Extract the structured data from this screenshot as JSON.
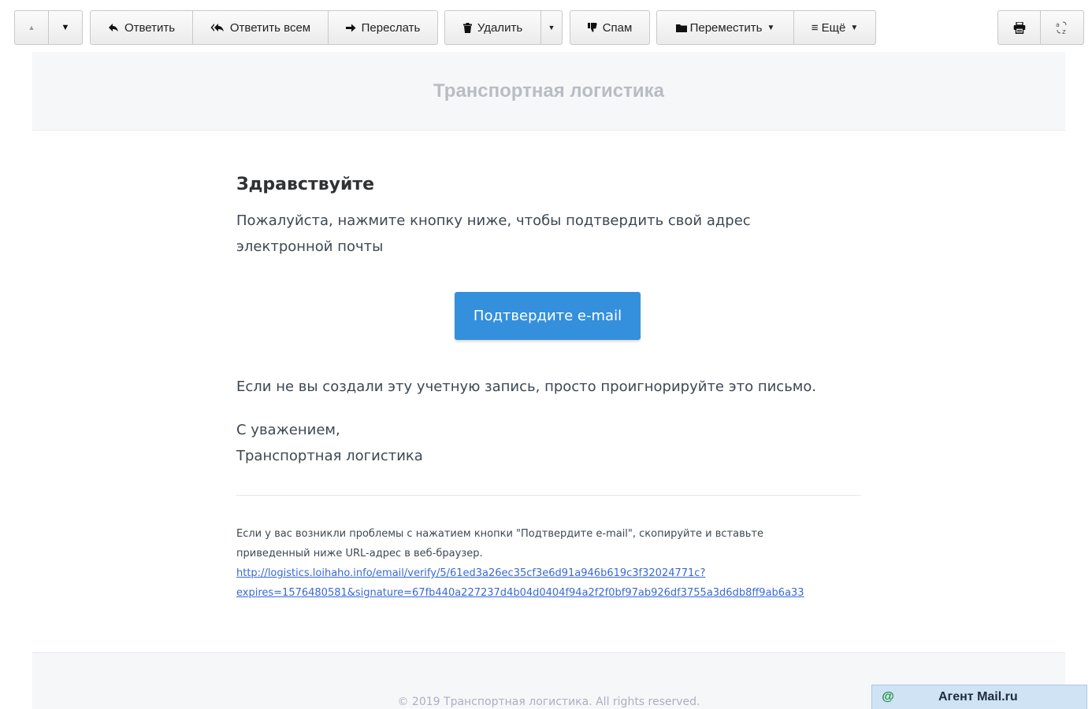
{
  "toolbar": {
    "prev_label": "▲",
    "next_label": "▼",
    "reply_label": "Ответить",
    "reply_all_label": "Ответить всем",
    "forward_label": "Переслать",
    "delete_label": "Удалить",
    "delete_menu_label": "▼",
    "spam_label": "Спам",
    "move_label": "Переместить",
    "more_label": "≡ Ещё",
    "dropdown_caret": "▼"
  },
  "email": {
    "header_brand": "Транспортная логистика",
    "greeting": "Здравствуйте",
    "intro_line1": "Пожалуйста, нажмите кнопку ниже, чтобы подтвердить свой адрес",
    "intro_line2": "электронной почты",
    "button_label": "Подтвердите e-mail",
    "ignore_text": "Если не вы создали эту учетную запись, просто проигнорируйте это письмо.",
    "regards_line1": "С уважением,",
    "regards_line2": "Транспортная логистика",
    "subcopy_line1": "Если у вас возникли проблемы с нажатием кнопки \"Подтвердите e-mail\", скопируйте и вставьте",
    "subcopy_line2": "приведенный ниже URL-адрес в веб-браузер.",
    "url_line1": "http://logistics.loihaho.info/email/verify/5/61ed3a26ec35cf3e6d91a946b619c3f32024771c?",
    "url_line2": "expires=1576480581&signature=67fb440a227237d4b04d0404f94a2f2f0bf97ab926df3755a3d6db8ff9ab6a33",
    "copyright": "© 2019 Транспортная логистика. All rights reserved."
  },
  "agent": {
    "at_symbol": "@",
    "label": "Агент Mail.ru"
  },
  "colors": {
    "accent_button": "#3490dc",
    "link": "#3869d4",
    "agent_bg": "#cfe3f5"
  }
}
